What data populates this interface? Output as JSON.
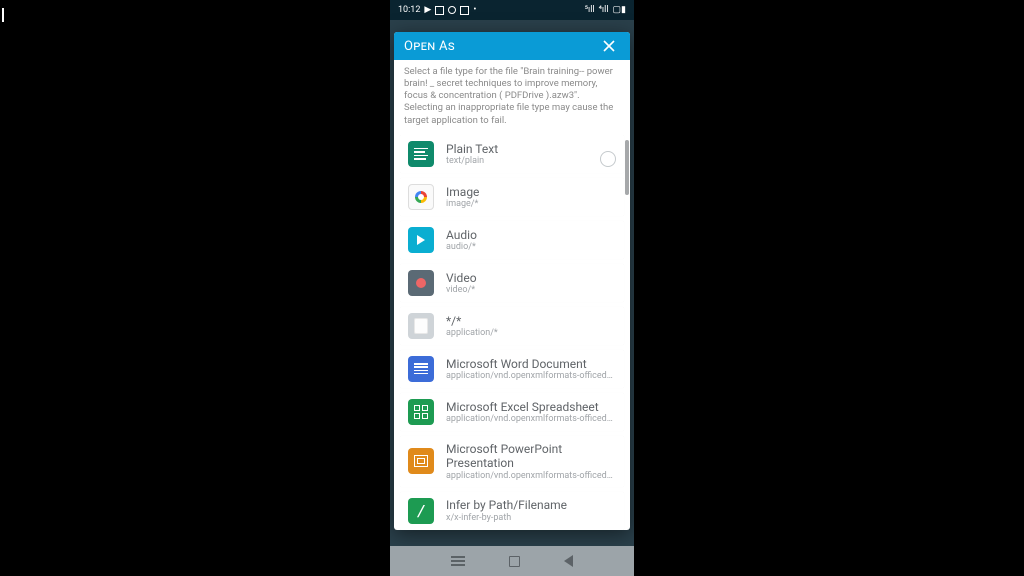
{
  "statusbar": {
    "time": "10:12",
    "indicators": [
      "youtube",
      "message",
      "mute",
      "facebook",
      "dot"
    ],
    "right": [
      "signal-5",
      "signal-4",
      "battery-80"
    ]
  },
  "dialog": {
    "title": "Open As",
    "description": "Select a file type for the file \"Brain training-- power brain! _ secret techniques to improve memory, focus & concentration ( PDFDrive ).azw3\". Selecting an inappropriate file type may cause the target application to fail."
  },
  "items": [
    {
      "label": "Plain Text",
      "mime": "text/plain",
      "icon": "text",
      "radio_visible": true
    },
    {
      "label": "Image",
      "mime": "image/*",
      "icon": "image"
    },
    {
      "label": "Audio",
      "mime": "audio/*",
      "icon": "audio"
    },
    {
      "label": "Video",
      "mime": "video/*",
      "icon": "video"
    },
    {
      "label": "*/*",
      "mime": "application/*",
      "icon": "generic"
    },
    {
      "label": "Microsoft Word Document",
      "mime": "application/vnd.openxmlformats-officedo..",
      "icon": "word"
    },
    {
      "label": "Microsoft Excel Spreadsheet",
      "mime": "application/vnd.openxmlformats-officedo..",
      "icon": "excel"
    },
    {
      "label": "Microsoft PowerPoint Presentation",
      "mime": "application/vnd.openxmlformats-officedo..",
      "icon": "ppt"
    },
    {
      "label": "Infer by Path/Filename",
      "mime": "x/x-infer-by-path",
      "icon": "infer"
    }
  ],
  "colors": {
    "header": "#0a9bd6"
  }
}
